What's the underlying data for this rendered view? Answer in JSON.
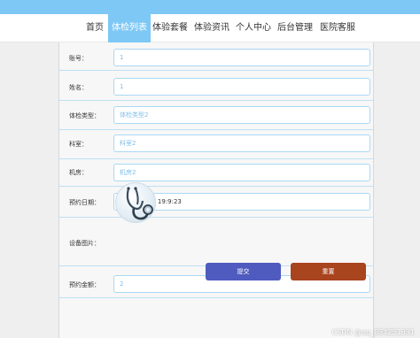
{
  "nav": {
    "items": [
      {
        "label": "首页",
        "active": false
      },
      {
        "label": "体检列表",
        "active": true
      },
      {
        "label": "体验套餐",
        "active": false
      },
      {
        "label": "体验资讯",
        "active": false
      },
      {
        "label": "个人中心",
        "active": false
      },
      {
        "label": "后台管理",
        "active": false
      },
      {
        "label": "医院客服",
        "active": false
      }
    ]
  },
  "form": {
    "account": {
      "label": "账号：",
      "value": "1"
    },
    "name": {
      "label": "姓名：",
      "value": "1"
    },
    "exam_type": {
      "label": "体检类型：",
      "value": "体检类型2"
    },
    "department": {
      "label": "科室：",
      "value": "科室2"
    },
    "room": {
      "label": "机房：",
      "value": "机房2"
    },
    "appointment_date": {
      "label": "预约日期：",
      "value": "2021-12-01 19:9:23"
    },
    "equipment_image": {
      "label": "设备图片：",
      "image": "stethoscope-image"
    },
    "appointment_amount": {
      "label": "预约金额：",
      "value": "2"
    }
  },
  "buttons": {
    "submit": "提交",
    "reset": "重置"
  },
  "watermark": "CSDN @qq_834251331",
  "colors": {
    "accent": "#7ec8f5",
    "submit_button": "#4f5bbf",
    "reset_button": "#a8441e",
    "field_border": "#a9d8f4"
  }
}
